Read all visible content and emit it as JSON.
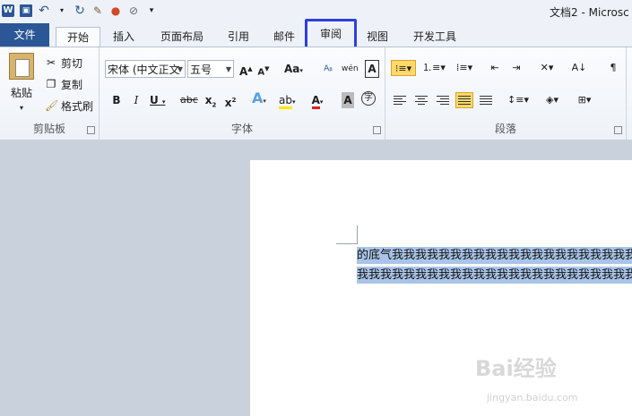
{
  "window": {
    "title": "文档2 - Microsc"
  },
  "tabs": [
    {
      "label": "文件"
    },
    {
      "label": "开始"
    },
    {
      "label": "插入"
    },
    {
      "label": "页面布局"
    },
    {
      "label": "引用"
    },
    {
      "label": "邮件"
    },
    {
      "label": "审阅"
    },
    {
      "label": "视图"
    },
    {
      "label": "开发工具"
    }
  ],
  "clipboard": {
    "paste": "粘贴",
    "cut": "剪切",
    "copy": "复制",
    "format_painter": "格式刷",
    "group": "剪贴板"
  },
  "font": {
    "name": "宋体 (中文正文",
    "size": "五号",
    "group": "字体"
  },
  "paragraph": {
    "group": "段落"
  },
  "document": {
    "line1": "的底气我我我我我我我我我我我我我我我我我我我我我我我我我我我",
    "line2": "我我我我我我我我我我我我我我我我我我我我我我我我我我我我我我"
  },
  "watermark": {
    "brand": "Bai经验",
    "url": "jingyan.baidu.com"
  },
  "colors": {
    "file_tab": "#2b5797",
    "highlight_box": "#2d3fe0",
    "selection": "#a9c4e8"
  }
}
